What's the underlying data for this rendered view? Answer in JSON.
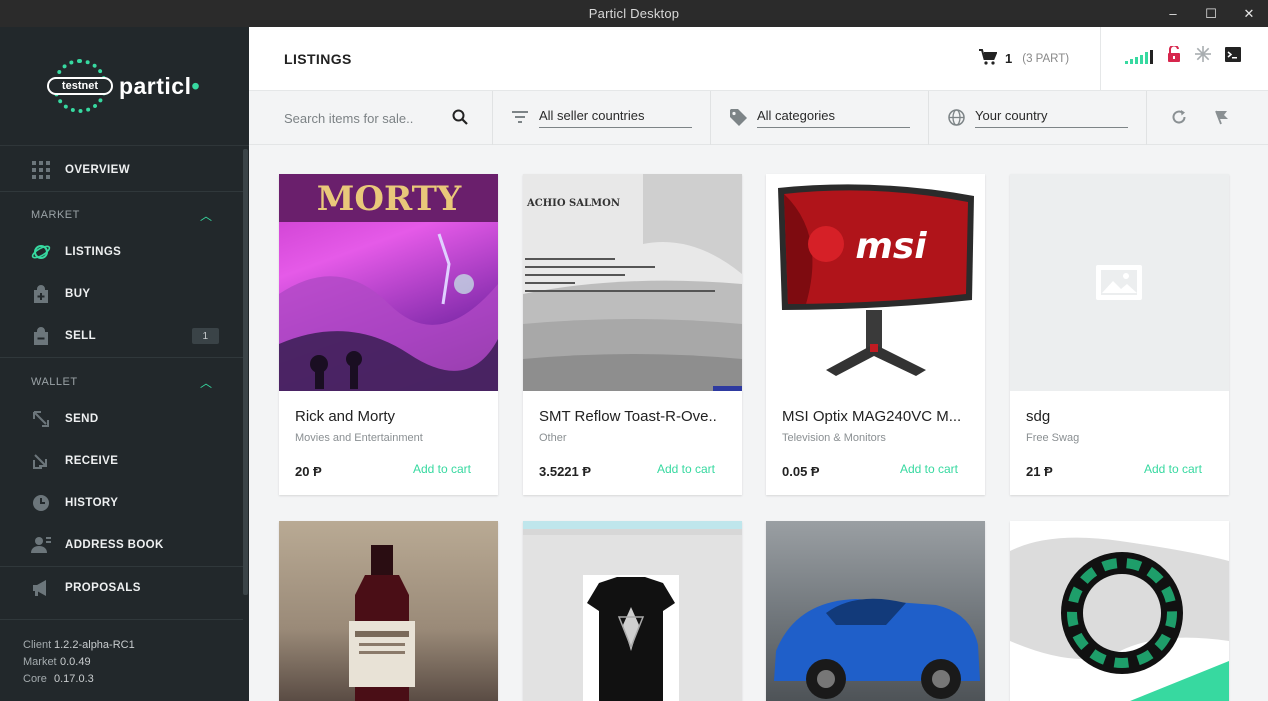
{
  "window": {
    "title": "Particl Desktop",
    "controls": [
      "–",
      "☐",
      "✕"
    ]
  },
  "brand": {
    "badge": "testnet",
    "name": "particl",
    "accent": "#37d9a0"
  },
  "sidebar": {
    "overview": "OVERVIEW",
    "market_label": "MARKET",
    "wallet_label": "WALLET",
    "listings": "LISTINGS",
    "buy": "BUY",
    "sell": "SELL",
    "sell_badge": "1",
    "send": "SEND",
    "receive": "RECEIVE",
    "history": "HISTORY",
    "address_book": "ADDRESS BOOK",
    "proposals": "PROPOSALS"
  },
  "versions": {
    "client_label": "Client",
    "client": "1.2.2-alpha-RC1",
    "market_label": "Market",
    "market": "0.0.49",
    "core_label": "Core",
    "core": "0.17.0.3"
  },
  "header": {
    "title": "LISTINGS",
    "cart_count": "1",
    "cart_part": "(3 PART)"
  },
  "filters": {
    "search_placeholder": "Search items for sale..",
    "seller_countries": "All seller countries",
    "categories": "All categories",
    "country": "Your country"
  },
  "listings": [
    {
      "name": "Rick and Morty",
      "category": "Movies and Entertainment",
      "price": "20 Ᵽ",
      "action": "Add to cart"
    },
    {
      "name": "SMT Reflow Toast-R-Ove..",
      "category": "Other",
      "price": "3.5221 Ᵽ",
      "action": "Add to cart",
      "image_text": "ACHIO SALMON"
    },
    {
      "name": "MSI Optix MAG240VC M...",
      "category": "Television & Monitors",
      "price": "0.05 Ᵽ",
      "action": "Add to cart",
      "image_text": "msi"
    },
    {
      "name": "sdg",
      "category": "Free Swag",
      "price": "21 Ᵽ",
      "action": "Add to cart"
    }
  ],
  "thumb_text": {
    "morty": "MORTY"
  }
}
